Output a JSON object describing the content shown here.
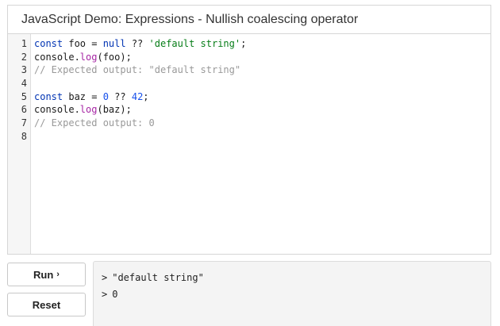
{
  "editor": {
    "title": "JavaScript Demo: Expressions - Nullish coalescing operator",
    "line_numbers": [
      "1",
      "2",
      "3",
      "4",
      "5",
      "6",
      "7",
      "8"
    ],
    "lines": [
      [
        {
          "t": "const",
          "c": "kw"
        },
        {
          "t": " foo = ",
          "c": ""
        },
        {
          "t": "null",
          "c": "lit"
        },
        {
          "t": " ?? ",
          "c": ""
        },
        {
          "t": "'default string'",
          "c": "str"
        },
        {
          "t": ";",
          "c": ""
        }
      ],
      [
        {
          "t": "console.",
          "c": ""
        },
        {
          "t": "log",
          "c": "fn"
        },
        {
          "t": "(foo);",
          "c": ""
        }
      ],
      [
        {
          "t": "// Expected output: \"default string\"",
          "c": "cm"
        }
      ],
      [],
      [
        {
          "t": "const",
          "c": "kw"
        },
        {
          "t": " baz = ",
          "c": ""
        },
        {
          "t": "0",
          "c": "num"
        },
        {
          "t": " ?? ",
          "c": ""
        },
        {
          "t": "42",
          "c": "num"
        },
        {
          "t": ";",
          "c": ""
        }
      ],
      [
        {
          "t": "console.",
          "c": ""
        },
        {
          "t": "log",
          "c": "fn"
        },
        {
          "t": "(baz);",
          "c": ""
        }
      ],
      [
        {
          "t": "// Expected output: 0",
          "c": "cm"
        }
      ],
      []
    ]
  },
  "buttons": {
    "run_label": "Run",
    "run_icon": "›",
    "reset_label": "Reset"
  },
  "console": {
    "prompt": ">",
    "outputs": [
      "\"default string\"",
      "0"
    ]
  }
}
